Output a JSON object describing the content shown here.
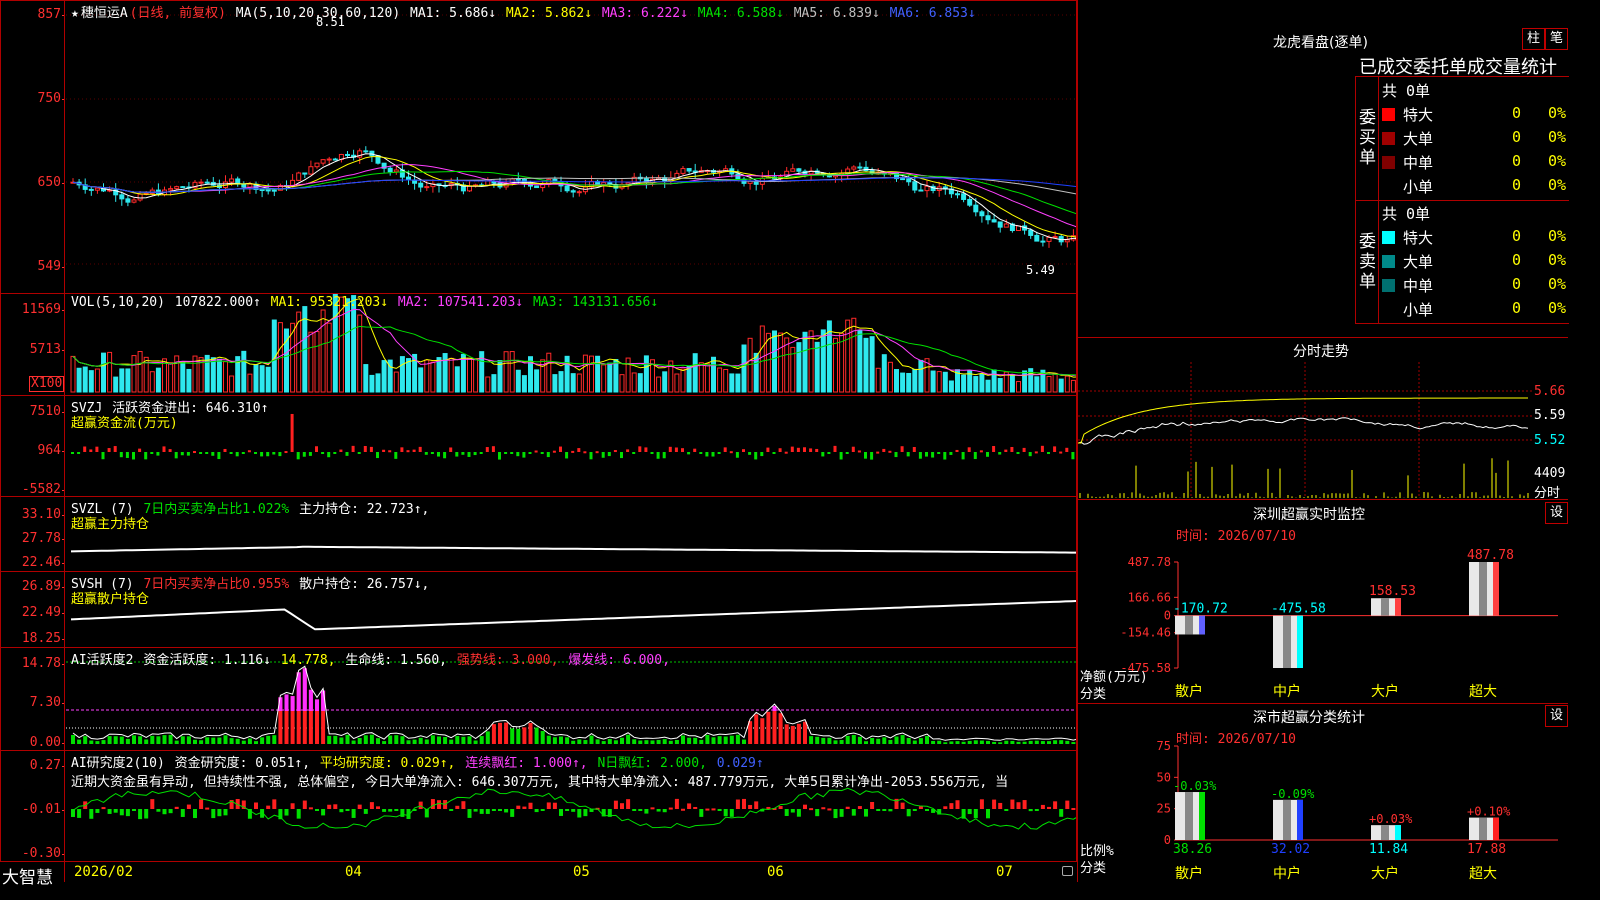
{
  "colors": {
    "up": "#ff2a2a",
    "down": "#2ee8ee",
    "white": "#ffffff",
    "yellow": "#ffff00",
    "magenta": "#ff40ff",
    "green": "#00e000",
    "blue": "#2040ff",
    "grid": "#a00000",
    "red_text": "#ff3030"
  },
  "kline": {
    "title_star": "★",
    "title": "穗恒运A",
    "period": "(日线, 前复权)",
    "ma_label": "MA(5,10,20,30,60,120)",
    "ma": [
      {
        "t": "MA1: 5.686↓"
      },
      {
        "t": "MA2: 5.862↓"
      },
      {
        "t": "MA3: 6.222↓"
      },
      {
        "t": "MA4: 6.588↓"
      },
      {
        "t": "MA5: 6.839↓"
      },
      {
        "t": "MA6: 6.853↓"
      }
    ],
    "y_ticks": [
      "857",
      "750",
      "650",
      "549"
    ],
    "high_mark": "8.51",
    "low_mark": "5.49"
  },
  "vol": {
    "label": "VOL(5,10,20)",
    "value": "107822.000↑",
    "ma1": "MA1: 95321.203↓",
    "ma2": "MA2: 107541.203↓",
    "ma3": "MA3: 143131.656↓",
    "y_ticks": [
      "11569",
      "5713"
    ],
    "unit": "X100"
  },
  "svzj": {
    "label": "SVZJ",
    "name": "活跃资金进出: 646.310↑",
    "sub": "超赢资金流(万元)",
    "y_ticks": [
      "7510",
      "964",
      "-5582"
    ]
  },
  "svzl": {
    "label": "SVZL (7)",
    "desc": "7日内买卖净占比1.022%",
    "hold": "主力持仓: 22.723↑,",
    "sub": "超赢主力持仓",
    "y_ticks": [
      "33.10",
      "27.78",
      "22.46"
    ]
  },
  "svsh": {
    "label": "SVSH (7)",
    "desc": "7日内买卖净占比0.955%",
    "hold": "散户持仓: 26.757↓,",
    "sub": "超赢散户持仓",
    "y_ticks": [
      "26.89",
      "22.49",
      "18.25"
    ]
  },
  "ai1": {
    "label": "AI活跃度2",
    "a": "资金活跃度: 1.116↓",
    "b": "14.778,",
    "c": "生命线: 1.560,",
    "d": "强势线: 3.000,",
    "e": "爆发线: 6.000,",
    "y_ticks": [
      "14.78",
      "7.30",
      "0.00"
    ]
  },
  "ai2": {
    "label": "AI研究度2(10)",
    "a": "资金研究度: 0.051↑,",
    "b": "平均研究度: 0.029↑,",
    "c": "连续飘红: 1.000↑,",
    "d": "N日飘红: 2.000,",
    "e": "0.029↑",
    "comment": "近期大资金虽有异动, 但持续性不强, 总体偏空, 今日大单净流入: 646.307万元, 其中特大单净流入: 487.779万元, 大单5日累计净出-2053.556万元, 当",
    "y_ticks": [
      "0.27",
      "-0.01",
      "-0.30"
    ]
  },
  "xaxis": {
    "labels": [
      "2026/02",
      "04",
      "05",
      "06",
      "07"
    ],
    "logo": "大智慧"
  },
  "lhb": {
    "title": "龙虎看盘(逐单)",
    "tab1": "柱",
    "tab2": "笔",
    "headline": "已成交委托单成交量统计",
    "buy_label": "委买单",
    "sell_label": "委卖单",
    "buy_total": "共 0单",
    "sell_total": "共 0单",
    "buy": [
      {
        "name": "特大",
        "v": "0",
        "p": "0%",
        "c": "#ff0000"
      },
      {
        "name": "大单",
        "v": "0",
        "p": "0%",
        "c": "#a00000"
      },
      {
        "name": "中单",
        "v": "0",
        "p": "0%",
        "c": "#800000"
      },
      {
        "name": "小单",
        "v": "0",
        "p": "0%",
        "c": ""
      }
    ],
    "sell": [
      {
        "name": "特大",
        "v": "0",
        "p": "0%",
        "c": "#00ffff"
      },
      {
        "name": "大单",
        "v": "0",
        "p": "0%",
        "c": "#008a8a"
      },
      {
        "name": "中单",
        "v": "0",
        "p": "0%",
        "c": "#007070"
      },
      {
        "name": "小单",
        "v": "0",
        "p": "0%",
        "c": ""
      }
    ]
  },
  "fenshi": {
    "title": "分时走势",
    "y_ticks": [
      "5.66",
      "5.59",
      "5.52"
    ],
    "vol": "4409",
    "vol_unit": "分时"
  },
  "monitor": {
    "title": "深圳超赢实时监控",
    "set": "设",
    "date": "时间: 2026/07/10",
    "ylabel": "净额(万元)",
    "xlabel": "分类"
  },
  "classify": {
    "title": "深市超赢分类统计",
    "set": "设",
    "date": "时间: 2026/07/10",
    "ylabel": "比例%",
    "xlabel": "分类"
  },
  "chart_data": [
    {
      "type": "bar",
      "title": "深圳超赢实时监控",
      "categories": [
        "散户",
        "中户",
        "大户",
        "超大"
      ],
      "values": [
        -170.72,
        -475.58,
        158.53,
        487.78
      ],
      "ylim": [
        -475.58,
        487.78
      ],
      "y_ticks": [
        487.78,
        166.66,
        0,
        -154.46,
        -475.58
      ]
    },
    {
      "type": "bar",
      "title": "深市超赢分类统计",
      "categories": [
        "散户",
        "中户",
        "大户",
        "超大"
      ],
      "values": [
        38.26,
        32.02,
        11.84,
        17.88
      ],
      "changes": [
        "-0.03%",
        "-0.09%",
        "+0.03%",
        "+0.10%"
      ],
      "ylim": [
        0,
        75
      ],
      "y_ticks": [
        75,
        50,
        25,
        0
      ]
    }
  ]
}
